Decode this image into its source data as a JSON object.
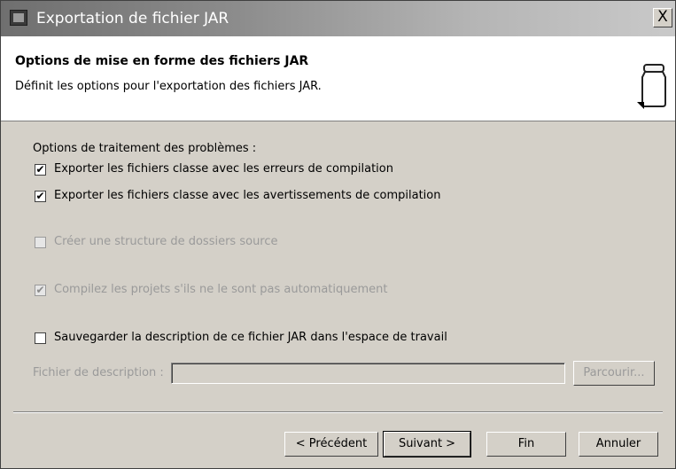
{
  "window": {
    "title": "Exportation de fichier JAR",
    "close_label": "X"
  },
  "header": {
    "title": "Options de mise en forme des fichiers JAR",
    "description": "Définit les options pour l'exportation des fichiers JAR."
  },
  "options": {
    "group_label": "Options de traitement des problèmes :",
    "export_errors": {
      "label": "Exporter les fichiers classe avec les erreurs de compilation",
      "checked": true,
      "enabled": true
    },
    "export_warnings": {
      "label": "Exporter les fichiers classe avec les avertissements de compilation",
      "checked": true,
      "enabled": true
    },
    "create_source_structure": {
      "label": "Créer une structure de dossiers source",
      "checked": false,
      "enabled": false
    },
    "compile_projects": {
      "label": "Compilez les projets s'ils ne le sont pas automatiquement",
      "checked": true,
      "enabled": false
    },
    "save_description": {
      "label": "Sauvegarder la description de ce fichier JAR dans l'espace de travail",
      "checked": false,
      "enabled": true
    }
  },
  "description_file": {
    "label": "Fichier de description :",
    "value": "",
    "browse_label": "Parcourir..."
  },
  "buttons": {
    "previous": "< Précédent",
    "next": "Suivant >",
    "finish": "Fin",
    "cancel": "Annuler"
  },
  "checkmark": "✔"
}
